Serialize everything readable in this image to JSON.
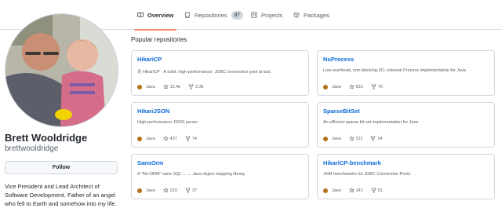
{
  "tabs": [
    {
      "label": "Overview",
      "icon": "book-icon",
      "active": true
    },
    {
      "label": "Repositories",
      "icon": "repo-icon",
      "count": "87"
    },
    {
      "label": "Projects",
      "icon": "project-icon"
    },
    {
      "label": "Packages",
      "icon": "package-icon"
    }
  ],
  "profile": {
    "name": "Brett Wooldridge",
    "login": "brettwooldridge",
    "follow_label": "Follow",
    "bio": "Vice President and Lead Architect of Software Development. Father of an angel who fell to Earth and somehow into my life."
  },
  "popular": {
    "title": "Popular repositories",
    "repos": [
      {
        "name": "HikariCP",
        "description": "光 HikariCP · A solid, high-performance, JDBC connection pool at last.",
        "language": "Java",
        "stars": "15.4k",
        "forks": "2.3k"
      },
      {
        "name": "NuProcess",
        "description": "Low-overhead, non-blocking I/O, external Process implementation for Java",
        "language": "Java",
        "stars": "531",
        "forks": "76"
      },
      {
        "name": "HikariJSON",
        "description": "High-performance JSON parser",
        "language": "Java",
        "stars": "437",
        "forks": "74"
      },
      {
        "name": "SparseBitSet",
        "description": "An efficient sparse bit set implementation for Java",
        "language": "Java",
        "stars": "211",
        "forks": "24"
      },
      {
        "name": "SansOrm",
        "description": "A \"No-ORM\" sane SQL ←→ Java object mapping library",
        "language": "Java",
        "stars": "210",
        "forks": "37"
      },
      {
        "name": "HikariCP-benchmark",
        "description": "JHM benchmarks for JDBC Connection Pools",
        "language": "Java",
        "stars": "141",
        "forks": "51"
      }
    ]
  },
  "colors": {
    "accent": "#fd8c73",
    "link": "#0969da",
    "java": "#b07219"
  }
}
